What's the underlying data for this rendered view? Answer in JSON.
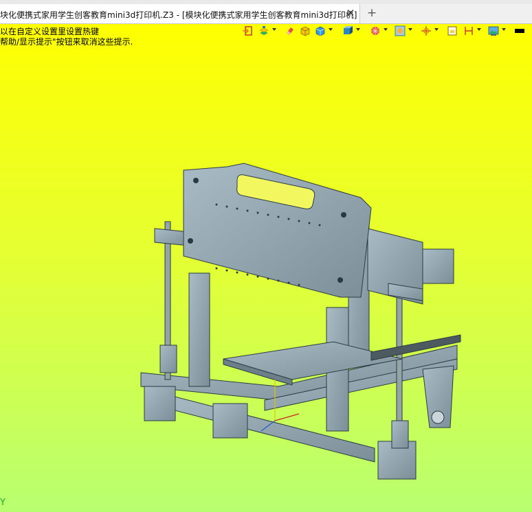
{
  "tab": {
    "title": "块化便携式家用学生创客教育mini3d打印机.Z3 - [模块化便携式家用学生创客教育mini3d打印机]",
    "close_label": "✕",
    "add_label": "+"
  },
  "viewport": {
    "hint_line1": "以在自定义设置里设置热键",
    "hint_line2": "帮助/显示提示\"按钮来取消这些提示.",
    "axis_label": "Y",
    "colors": {
      "bg_top": "#ffff00",
      "bg_bottom": "#b8ff70",
      "model": "#8fa3ad"
    }
  },
  "toolbar": {
    "icons": [
      "exit-icon",
      "layers-icon",
      "eraser-icon",
      "solid-box-icon",
      "shaded-box-icon",
      "view-cube-icon",
      "render-mode-icon",
      "display-filter-icon",
      "pick-target-icon",
      "select-box-icon",
      "dimension-icon",
      "image-icon",
      "color-block-icon"
    ]
  }
}
